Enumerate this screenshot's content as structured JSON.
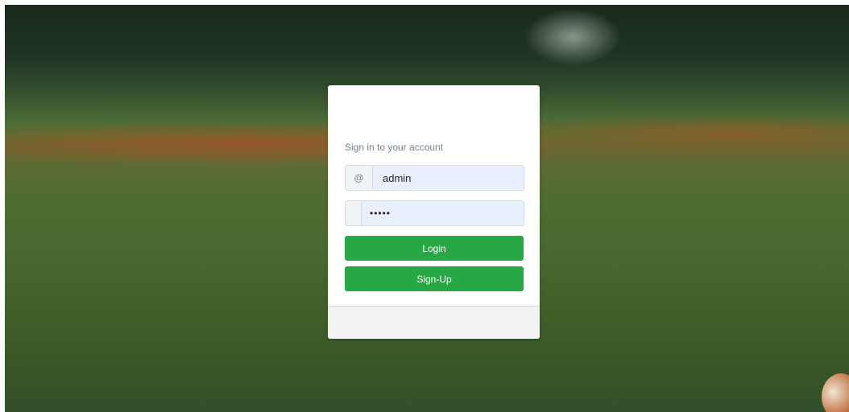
{
  "login_card": {
    "subtitle": "Sign in to your account",
    "username": {
      "addon_icon": "@",
      "value": "admin"
    },
    "password": {
      "value_masked": "•••••"
    },
    "login_label": "Login",
    "signup_label": "Sign-Up",
    "accent_color": "#28a745"
  }
}
